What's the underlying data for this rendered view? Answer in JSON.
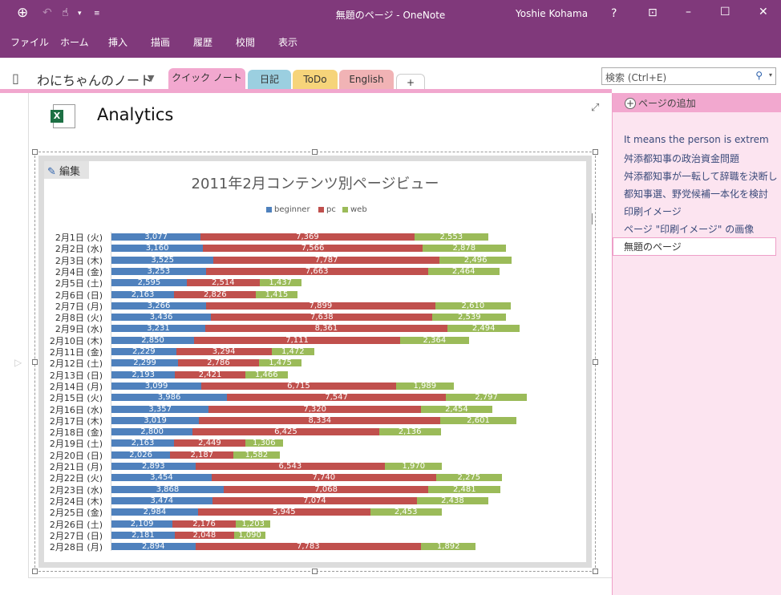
{
  "window": {
    "title": "無題のページ - OneNote",
    "user": "Yoshie Kohama",
    "help": "?"
  },
  "menu": [
    "ファイル",
    "ホーム",
    "挿入",
    "描画",
    "履歴",
    "校閲",
    "表示"
  ],
  "notebook": {
    "name": "わにちゃんのノート",
    "tabs": [
      {
        "label": "クイック ノート",
        "color": "#F2A8CF"
      },
      {
        "label": "日記",
        "color": "#9BCFE0"
      },
      {
        "label": "ToDo",
        "color": "#F6D47A"
      },
      {
        "label": "English",
        "color": "#F1B3B5"
      },
      {
        "label": "+",
        "color": "#ffffff"
      }
    ]
  },
  "search": {
    "placeholder": "検索 (Ctrl+E)"
  },
  "page": {
    "title": "Analytics",
    "edit_label": "編集"
  },
  "sidebar": {
    "add_page": "ページの追加",
    "pages": [
      "It means the person is extrem",
      "舛添都知事の政治資金問題",
      "舛添都知事が一転して辞職を決断し",
      "都知事選、野党候補一本化を検討",
      "印刷イメージ",
      "ページ \"印刷イメージ\" の画像",
      "無題のページ"
    ],
    "selected": 6
  },
  "chart_data": {
    "type": "bar",
    "orientation": "horizontal",
    "stacked": true,
    "title": "2011年2月コンテンツ別ページビュー",
    "legend_position": "top",
    "categories": [
      "2月1日 (火)",
      "2月2日 (水)",
      "2月3日 (木)",
      "2月4日 (金)",
      "2月5日 (土)",
      "2月6日 (日)",
      "2月7日 (月)",
      "2月8日 (火)",
      "2月9日 (水)",
      "2月10日 (木)",
      "2月11日 (金)",
      "2月12日 (土)",
      "2月13日 (日)",
      "2月14日 (月)",
      "2月15日 (火)",
      "2月16日 (水)",
      "2月17日 (木)",
      "2月18日 (金)",
      "2月19日 (土)",
      "2月20日 (日)",
      "2月21日 (月)",
      "2月22日 (火)",
      "2月23日 (水)",
      "2月24日 (木)",
      "2月25日 (金)",
      "2月26日 (土)",
      "2月27日 (日)",
      "2月28日 (月)"
    ],
    "series": [
      {
        "name": "beginner",
        "color": "#4F81BD",
        "values": [
          3077,
          3160,
          3525,
          3253,
          2595,
          2163,
          3266,
          3436,
          3231,
          2850,
          2229,
          2299,
          2193,
          3099,
          3986,
          3357,
          3019,
          2800,
          2163,
          2026,
          2893,
          3454,
          3868,
          3474,
          2984,
          2109,
          2181,
          2894
        ]
      },
      {
        "name": "pc",
        "color": "#C0504D",
        "values": [
          7369,
          7566,
          7787,
          7663,
          2514,
          2826,
          7899,
          7638,
          8361,
          7111,
          3294,
          2786,
          2421,
          6715,
          7547,
          7320,
          8334,
          6425,
          2449,
          2187,
          6543,
          7740,
          7068,
          7074,
          5945,
          2176,
          2048,
          7783
        ]
      },
      {
        "name": "web",
        "color": "#9BBB59",
        "values": [
          2553,
          2878,
          2496,
          2464,
          1437,
          1415,
          2610,
          2539,
          2494,
          2364,
          1472,
          1475,
          1466,
          1989,
          2797,
          2454,
          2601,
          2136,
          1306,
          1582,
          1970,
          2275,
          2481,
          2438,
          2453,
          1203,
          1090,
          1892
        ]
      }
    ]
  }
}
